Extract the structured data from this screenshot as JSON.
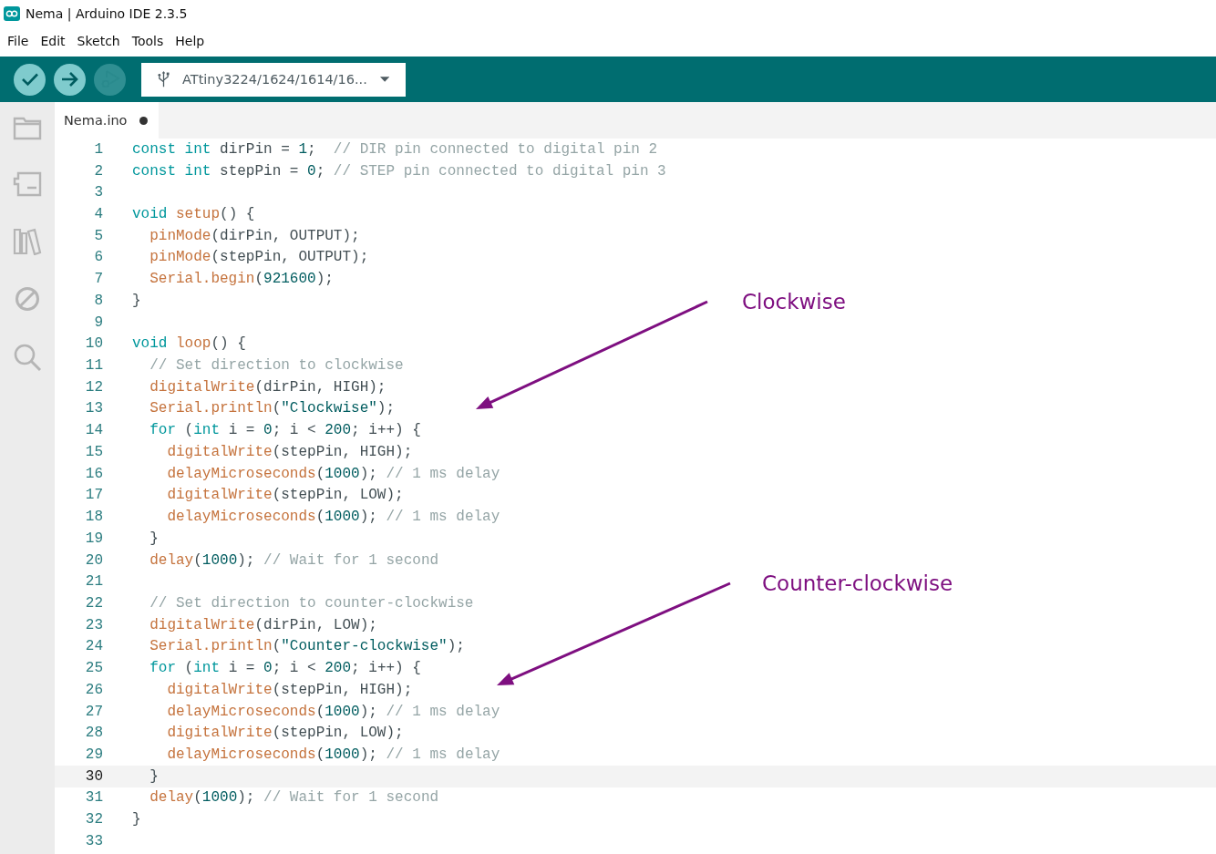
{
  "window": {
    "title": "Nema | Arduino IDE 2.3.5"
  },
  "menu": [
    "File",
    "Edit",
    "Sketch",
    "Tools",
    "Help"
  ],
  "toolbar": {
    "buttons": [
      {
        "kind": "verify",
        "disabled": false
      },
      {
        "kind": "upload",
        "disabled": false
      },
      {
        "kind": "debug",
        "disabled": true
      }
    ],
    "board_selector": {
      "label": "ATtiny3224/1624/1614/16..."
    }
  },
  "tabs": [
    {
      "label": "Nema.ino",
      "modified": true,
      "selected": true
    }
  ],
  "editor": {
    "lines": [
      {
        "number": "1",
        "current": false,
        "tokens": [
          {
            "kind": "k",
            "text": "const int"
          },
          {
            "kind": "p",
            "text": " dirPin = "
          },
          {
            "kind": "n",
            "text": "1"
          },
          {
            "kind": "p",
            "text": ";  "
          },
          {
            "kind": "c",
            "text": "// DIR pin connected to digital pin 2"
          }
        ]
      },
      {
        "number": "2",
        "current": false,
        "tokens": [
          {
            "kind": "k",
            "text": "const int"
          },
          {
            "kind": "p",
            "text": " stepPin = "
          },
          {
            "kind": "n",
            "text": "0"
          },
          {
            "kind": "p",
            "text": "; "
          },
          {
            "kind": "c",
            "text": "// STEP pin connected to digital pin 3"
          }
        ]
      },
      {
        "number": "3",
        "current": false
      },
      {
        "number": "4",
        "current": false,
        "tokens": [
          {
            "kind": "k",
            "text": "void "
          },
          {
            "kind": "f",
            "text": "setup"
          },
          {
            "kind": "p",
            "text": "() {"
          }
        ]
      },
      {
        "number": "5",
        "current": false,
        "tokens": [
          {
            "kind": "f",
            "text": "  pinMode"
          },
          {
            "kind": "p",
            "text": "(dirPin, OUTPUT);"
          }
        ]
      },
      {
        "number": "6",
        "current": false,
        "tokens": [
          {
            "kind": "f",
            "text": "  pinMode"
          },
          {
            "kind": "p",
            "text": "(stepPin, OUTPUT);"
          }
        ]
      },
      {
        "number": "7",
        "current": false,
        "tokens": [
          {
            "kind": "f",
            "text": "  Serial.begin"
          },
          {
            "kind": "p",
            "text": "("
          },
          {
            "kind": "n",
            "text": "921600"
          },
          {
            "kind": "p",
            "text": ");"
          }
        ]
      },
      {
        "number": "8",
        "current": false,
        "tokens": [
          {
            "kind": "p",
            "text": "}"
          }
        ]
      },
      {
        "number": "9",
        "current": false
      },
      {
        "number": "10",
        "current": false,
        "tokens": [
          {
            "kind": "k",
            "text": "void "
          },
          {
            "kind": "f",
            "text": "loop"
          },
          {
            "kind": "p",
            "text": "() {"
          }
        ]
      },
      {
        "number": "11",
        "current": false,
        "tokens": [
          {
            "kind": "c",
            "text": "  // Set direction to clockwise"
          }
        ]
      },
      {
        "number": "12",
        "current": false,
        "tokens": [
          {
            "kind": "f",
            "text": "  digitalWrite"
          },
          {
            "kind": "p",
            "text": "(dirPin, HIGH);"
          }
        ]
      },
      {
        "number": "13",
        "current": false,
        "tokens": [
          {
            "kind": "f",
            "text": "  Serial.println"
          },
          {
            "kind": "p",
            "text": "("
          },
          {
            "kind": "n",
            "text": "\"Clockwise\""
          },
          {
            "kind": "p",
            "text": ");"
          }
        ]
      },
      {
        "number": "14",
        "current": false,
        "tokens": [
          {
            "kind": "k",
            "text": "  for"
          },
          {
            "kind": "p",
            "text": " ("
          },
          {
            "kind": "k",
            "text": "int"
          },
          {
            "kind": "p",
            "text": " i = "
          },
          {
            "kind": "n",
            "text": "0"
          },
          {
            "kind": "p",
            "text": "; i < "
          },
          {
            "kind": "n",
            "text": "200"
          },
          {
            "kind": "p",
            "text": "; i++) {"
          }
        ]
      },
      {
        "number": "15",
        "current": false,
        "tokens": [
          {
            "kind": "f",
            "text": "    digitalWrite"
          },
          {
            "kind": "p",
            "text": "(stepPin, HIGH);"
          }
        ]
      },
      {
        "number": "16",
        "current": false,
        "tokens": [
          {
            "kind": "f",
            "text": "    delayMicroseconds"
          },
          {
            "kind": "p",
            "text": "("
          },
          {
            "kind": "n",
            "text": "1000"
          },
          {
            "kind": "p",
            "text": "); "
          },
          {
            "kind": "c",
            "text": "// 1 ms delay"
          }
        ]
      },
      {
        "number": "17",
        "current": false,
        "tokens": [
          {
            "kind": "f",
            "text": "    digitalWrite"
          },
          {
            "kind": "p",
            "text": "(stepPin, LOW);"
          }
        ]
      },
      {
        "number": "18",
        "current": false,
        "tokens": [
          {
            "kind": "f",
            "text": "    delayMicroseconds"
          },
          {
            "kind": "p",
            "text": "("
          },
          {
            "kind": "n",
            "text": "1000"
          },
          {
            "kind": "p",
            "text": "); "
          },
          {
            "kind": "c",
            "text": "// 1 ms delay"
          }
        ]
      },
      {
        "number": "19",
        "current": false,
        "tokens": [
          {
            "kind": "p",
            "text": "  }"
          }
        ]
      },
      {
        "number": "20",
        "current": false,
        "tokens": [
          {
            "kind": "f",
            "text": "  delay"
          },
          {
            "kind": "p",
            "text": "("
          },
          {
            "kind": "n",
            "text": "1000"
          },
          {
            "kind": "p",
            "text": "); "
          },
          {
            "kind": "c",
            "text": "// Wait for 1 second"
          }
        ]
      },
      {
        "number": "21",
        "current": false
      },
      {
        "number": "22",
        "current": false,
        "tokens": [
          {
            "kind": "c",
            "text": "  // Set direction to counter-clockwise"
          }
        ]
      },
      {
        "number": "23",
        "current": false,
        "tokens": [
          {
            "kind": "f",
            "text": "  digitalWrite"
          },
          {
            "kind": "p",
            "text": "(dirPin, LOW);"
          }
        ]
      },
      {
        "number": "24",
        "current": false,
        "tokens": [
          {
            "kind": "f",
            "text": "  Serial.println"
          },
          {
            "kind": "p",
            "text": "("
          },
          {
            "kind": "n",
            "text": "\"Counter-clockwise\""
          },
          {
            "kind": "p",
            "text": ");"
          }
        ]
      },
      {
        "number": "25",
        "current": false,
        "tokens": [
          {
            "kind": "k",
            "text": "  for"
          },
          {
            "kind": "p",
            "text": " ("
          },
          {
            "kind": "k",
            "text": "int"
          },
          {
            "kind": "p",
            "text": " i = "
          },
          {
            "kind": "n",
            "text": "0"
          },
          {
            "kind": "p",
            "text": "; i < "
          },
          {
            "kind": "n",
            "text": "200"
          },
          {
            "kind": "p",
            "text": "; i++) {"
          }
        ]
      },
      {
        "number": "26",
        "current": false,
        "tokens": [
          {
            "kind": "f",
            "text": "    digitalWrite"
          },
          {
            "kind": "p",
            "text": "(stepPin, HIGH);"
          }
        ]
      },
      {
        "number": "27",
        "current": false,
        "tokens": [
          {
            "kind": "f",
            "text": "    delayMicroseconds"
          },
          {
            "kind": "p",
            "text": "("
          },
          {
            "kind": "n",
            "text": "1000"
          },
          {
            "kind": "p",
            "text": "); "
          },
          {
            "kind": "c",
            "text": "// 1 ms delay"
          }
        ]
      },
      {
        "number": "28",
        "current": false,
        "tokens": [
          {
            "kind": "f",
            "text": "    digitalWrite"
          },
          {
            "kind": "p",
            "text": "(stepPin, LOW);"
          }
        ]
      },
      {
        "number": "29",
        "current": false,
        "tokens": [
          {
            "kind": "f",
            "text": "    delayMicroseconds"
          },
          {
            "kind": "p",
            "text": "("
          },
          {
            "kind": "n",
            "text": "1000"
          },
          {
            "kind": "p",
            "text": "); "
          },
          {
            "kind": "c",
            "text": "// 1 ms delay"
          }
        ]
      },
      {
        "number": "30",
        "current": true,
        "tokens": [
          {
            "kind": "p",
            "text": "  }"
          }
        ]
      },
      {
        "number": "31",
        "current": false,
        "tokens": [
          {
            "kind": "f",
            "text": "  delay"
          },
          {
            "kind": "p",
            "text": "("
          },
          {
            "kind": "n",
            "text": "1000"
          },
          {
            "kind": "p",
            "text": "); "
          },
          {
            "kind": "c",
            "text": "// Wait for 1 second"
          }
        ]
      },
      {
        "number": "32",
        "current": false,
        "tokens": [
          {
            "kind": "p",
            "text": "}"
          }
        ]
      },
      {
        "number": "33",
        "current": false
      }
    ]
  },
  "annotations": [
    {
      "text": "Clockwise"
    },
    {
      "text": "Counter-clockwise"
    }
  ]
}
